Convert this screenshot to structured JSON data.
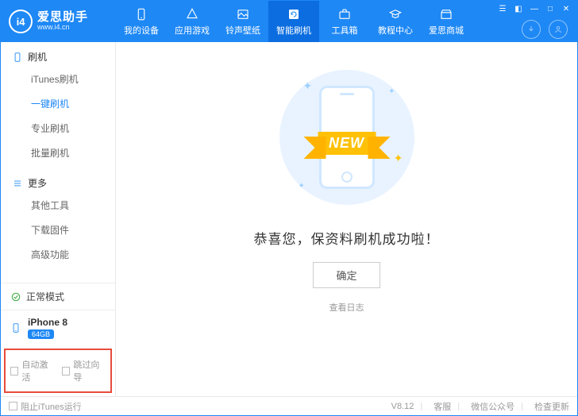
{
  "brand": {
    "logo_text": "i4",
    "title": "爱思助手",
    "url": "www.i4.cn"
  },
  "nav": {
    "items": [
      {
        "label": "我的设备"
      },
      {
        "label": "应用游戏"
      },
      {
        "label": "铃声壁纸"
      },
      {
        "label": "智能刷机"
      },
      {
        "label": "工具箱"
      },
      {
        "label": "教程中心"
      },
      {
        "label": "爱思商城"
      }
    ],
    "active_index": 3
  },
  "sidebar": {
    "sections": [
      {
        "title": "刷机",
        "items": [
          "iTunes刷机",
          "一键刷机",
          "专业刷机",
          "批量刷机"
        ],
        "active_index": 1
      },
      {
        "title": "更多",
        "items": [
          "其他工具",
          "下载固件",
          "高级功能"
        ],
        "active_index": -1
      }
    ],
    "status": {
      "label": "正常模式"
    },
    "device": {
      "name": "iPhone 8",
      "storage": "64GB"
    },
    "checks": {
      "auto_activate": "自动激活",
      "skip_guide": "跳过向导"
    }
  },
  "main": {
    "ribbon_text": "NEW",
    "success_title": "恭喜您，保资料刷机成功啦！",
    "ok_button": "确定",
    "view_log": "查看日志"
  },
  "footer": {
    "block_itunes": "阻止iTunes运行",
    "version": "V8.12",
    "support": "客服",
    "wechat": "微信公众号",
    "check_update": "检查更新"
  }
}
